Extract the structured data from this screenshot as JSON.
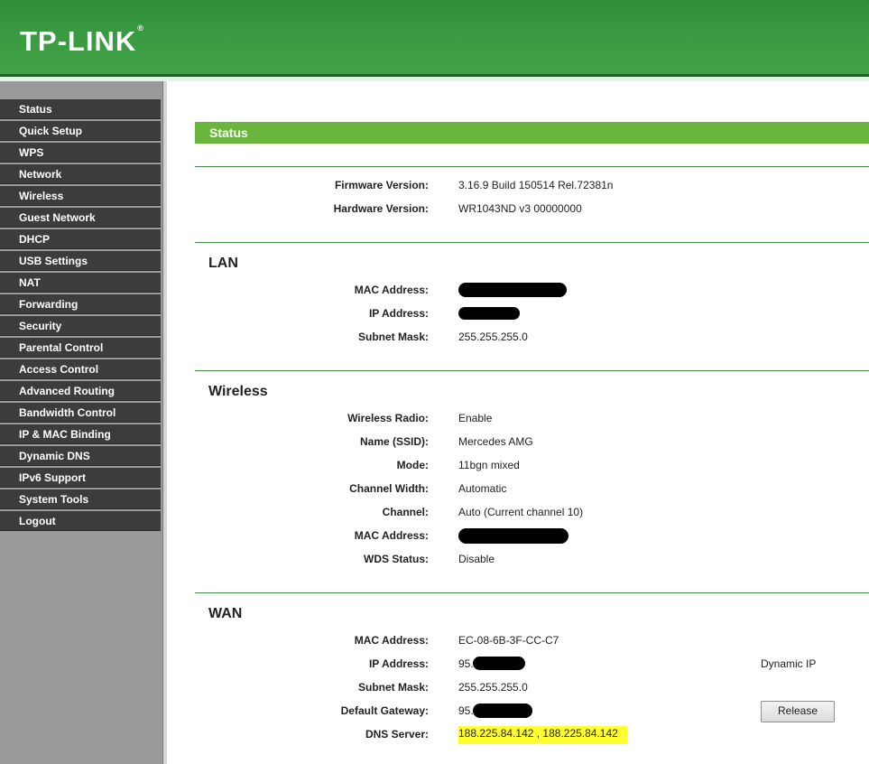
{
  "brand": {
    "logo_text": "TP-LINK",
    "logo_mark": "®"
  },
  "sidebar": {
    "items": [
      {
        "label": "Status"
      },
      {
        "label": "Quick Setup"
      },
      {
        "label": "WPS"
      },
      {
        "label": "Network"
      },
      {
        "label": "Wireless"
      },
      {
        "label": "Guest Network"
      },
      {
        "label": "DHCP"
      },
      {
        "label": "USB Settings"
      },
      {
        "label": "NAT"
      },
      {
        "label": "Forwarding"
      },
      {
        "label": "Security"
      },
      {
        "label": "Parental Control"
      },
      {
        "label": "Access Control"
      },
      {
        "label": "Advanced Routing"
      },
      {
        "label": "Bandwidth Control"
      },
      {
        "label": "IP & MAC Binding"
      },
      {
        "label": "Dynamic DNS"
      },
      {
        "label": "IPv6 Support"
      },
      {
        "label": "System Tools"
      },
      {
        "label": "Logout"
      }
    ]
  },
  "page": {
    "title": "Status"
  },
  "firmware": {
    "firmware_label": "Firmware Version:",
    "firmware_value": "3.16.9 Build 150514 Rel.72381n",
    "hardware_label": "Hardware Version:",
    "hardware_value": "WR1043ND v3 00000000"
  },
  "lan": {
    "title": "LAN",
    "mac_label": "MAC Address:",
    "ip_label": "IP Address:",
    "subnet_label": "Subnet Mask:",
    "subnet_value": "255.255.255.0"
  },
  "wireless": {
    "title": "Wireless",
    "radio_label": "Wireless Radio:",
    "radio_value": "Enable",
    "ssid_label": "Name (SSID):",
    "ssid_value": "Mercedes AMG",
    "mode_label": "Mode:",
    "mode_value": "11bgn mixed",
    "width_label": "Channel Width:",
    "width_value": "Automatic",
    "channel_label": "Channel:",
    "channel_value": "Auto (Current channel 10)",
    "mac_label": "MAC Address:",
    "wds_label": "WDS Status:",
    "wds_value": "Disable"
  },
  "wan": {
    "title": "WAN",
    "mac_label": "MAC Address:",
    "mac_value": "EC-08-6B-3F-CC-C7",
    "ip_label": "IP Address:",
    "ip_prefix": "95.",
    "connection_type": "Dynamic IP",
    "subnet_label": "Subnet Mask:",
    "subnet_value": "255.255.255.0",
    "gateway_label": "Default Gateway:",
    "gateway_prefix": "95.",
    "release_label": "Release",
    "dns_label": "DNS Server:",
    "dns_value": "188.225.84.142 , 188.225.84.142"
  },
  "colors": {
    "header_green": "#3a9a42",
    "status_bar_green": "#6ab63c",
    "menu_dark": "#3c3c3c",
    "highlight_yellow": "#ffff33"
  }
}
